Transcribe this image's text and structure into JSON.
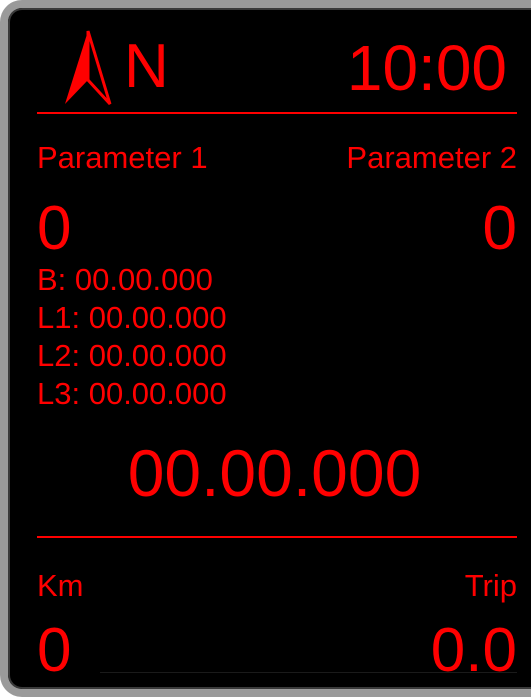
{
  "header": {
    "heading": "N",
    "clock": "10:00",
    "compass_icon": "north-arrow-icon"
  },
  "parameters": {
    "p1": {
      "label": "Parameter 1",
      "value": "0"
    },
    "p2": {
      "label": "Parameter 2",
      "value": "0"
    }
  },
  "coordinates": [
    "B: 00.00.000",
    "L1: 00.00.000",
    "L2: 00.00.000",
    "L3: 00.00.000"
  ],
  "main_value": "00.00.000",
  "odometer": {
    "km_label": "Km",
    "km_value": "0",
    "trip_label": "Trip",
    "trip_value": "0.0"
  },
  "colors": {
    "foreground": "#ff0000",
    "background": "#000000",
    "bezel": "#9a9a9a"
  }
}
